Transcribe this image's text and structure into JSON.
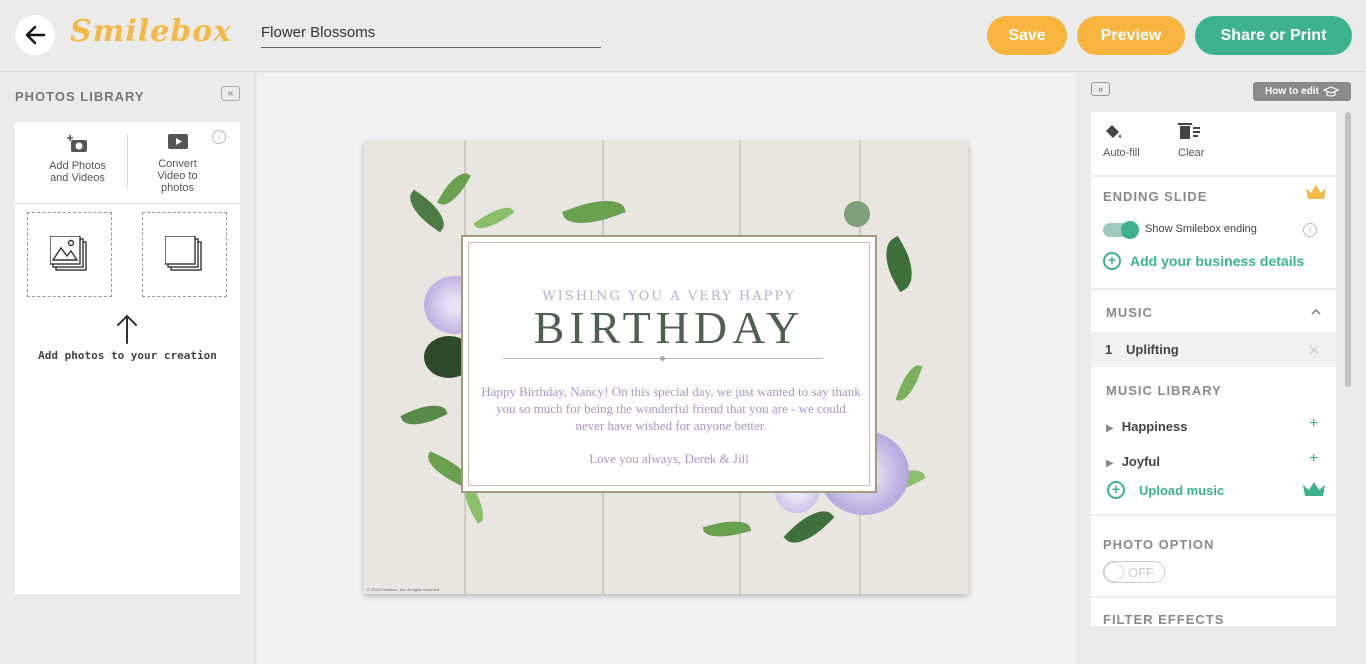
{
  "header": {
    "back_icon": "arrow-left-icon",
    "logo": "Smilebox",
    "title_value": "Flower Blossoms",
    "save_label": "Save",
    "preview_label": "Preview",
    "share_label": "Share or Print",
    "colors": {
      "save": "#f7b43e",
      "preview": "#f7b43e",
      "share": "#3db28f"
    }
  },
  "left_panel": {
    "title": "PHOTOS LIBRARY",
    "add_photos_label": "Add Photos and Videos",
    "convert_video_label": "Convert Video to photos",
    "info_glyph": "i",
    "hint": "Add photos to your creation"
  },
  "card": {
    "wish": "WISHING YOU A VERY HAPPY",
    "headline": "BIRTHDAY",
    "message": "Happy Birthday, Nancy! On this special day, we just wanted to say thank you so much for being the wonderful friend that you are - we could never have wished for anyone better.",
    "signature": "Love you always, Derek & Jill",
    "copyright": "© 2018 Smilebox, Inc. All rights reserved."
  },
  "right_panel": {
    "how_to_edit": "How to edit",
    "autofill_label": "Auto-fill",
    "clear_label": "Clear",
    "ending_slide": {
      "title": "ENDING SLIDE",
      "toggle_label": "Show Smilebox ending",
      "business_link": "Add your business details"
    },
    "music": {
      "title": "MUSIC",
      "track_index": "1",
      "track_name": "Uplifting",
      "library_title": "MUSIC LIBRARY",
      "library": [
        "Happiness",
        "Joyful"
      ],
      "upload_label": "Upload music"
    },
    "photo_option": {
      "title": "PHOTO OPTION",
      "state": "OFF"
    },
    "filter_effects": {
      "title": "FILTER EFFECTS"
    }
  }
}
